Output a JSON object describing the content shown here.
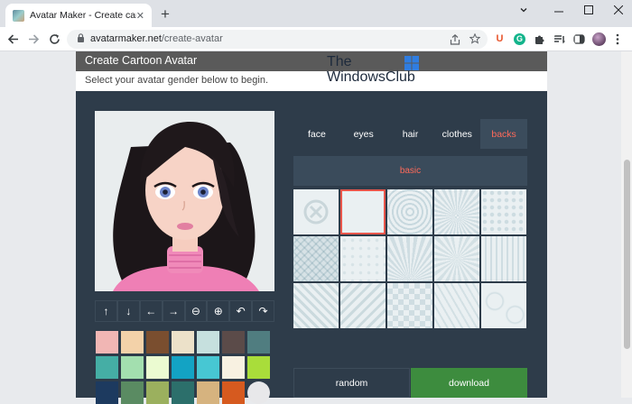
{
  "browser": {
    "tab_title": "Avatar Maker - Create cartoon av",
    "tab_close": "✕",
    "new_tab": "+",
    "url_domain": "avatarmaker.net",
    "url_path": "/create-avatar",
    "window_controls": [
      "⌄",
      "—",
      "▢",
      "✕"
    ]
  },
  "page": {
    "header_title": "Create Cartoon Avatar",
    "subheader": "Select your avatar gender below to begin.",
    "watermark_line1": "The",
    "watermark_line2": "WindowsClub",
    "controls": [
      {
        "icon": "↑",
        "name": "move-up-button"
      },
      {
        "icon": "↓",
        "name": "move-down-button"
      },
      {
        "icon": "←",
        "name": "move-left-button"
      },
      {
        "icon": "→",
        "name": "move-right-button"
      },
      {
        "icon": "⊖",
        "name": "zoom-out-button"
      },
      {
        "icon": "⊕",
        "name": "zoom-in-button"
      },
      {
        "icon": "↶",
        "name": "undo-button"
      },
      {
        "icon": "↷",
        "name": "redo-button"
      }
    ],
    "swatch_colors": [
      "#f1b6b4",
      "#f3d2a9",
      "#7a4e2f",
      "#ece1c9",
      "#c6e0de",
      "#5b4b49",
      "#507d80",
      "#45aea5",
      "#a3dfaf",
      "#ebfbd1",
      "#13a3c4",
      "#47c7d3",
      "#f8f1e1",
      "#a9dd3a",
      "#1d3a5f",
      "#5a8b62",
      "#9bb05e",
      "#2c6f6b",
      "#d6b37f",
      "#d65a1f",
      "#e8e8ea"
    ],
    "category_tabs": [
      "face",
      "eyes",
      "hair",
      "clothes",
      "backs"
    ],
    "active_tab": "backs",
    "subcategory": "basic",
    "random_label": "random",
    "download_label": "download",
    "accent_color": "#ff6a5a",
    "download_color": "#3d8c3e"
  }
}
